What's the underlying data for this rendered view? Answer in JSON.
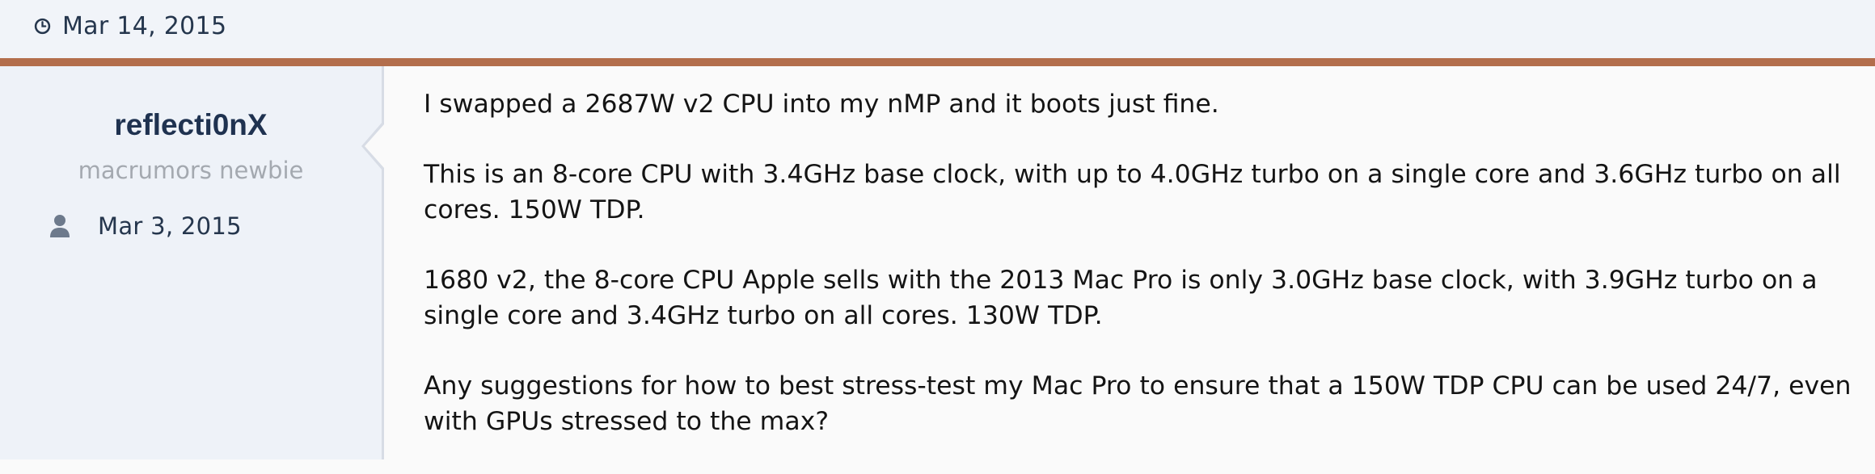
{
  "post": {
    "date": "Mar 14, 2015",
    "date_icon": "clock-icon"
  },
  "colors": {
    "header_bg": "#f1f4f9",
    "accent": "#b36e4c",
    "user_panel_bg": "#eef2f8",
    "username": "#1f3250",
    "user_title": "#a4a9b0",
    "body_text": "#141414"
  },
  "user": {
    "name": "reflecti0nX",
    "title": "macrumors newbie",
    "joined": "Mar 3, 2015",
    "joined_icon": "user-icon"
  },
  "message": {
    "paragraphs": [
      "I swapped a 2687W v2 CPU into my nMP and it boots just fine.",
      "This is an 8-core CPU with 3.4GHz base clock, with up to 4.0GHz turbo on a single core and 3.6GHz turbo on all cores. 150W TDP.",
      "1680 v2, the 8-core CPU Apple sells with the 2013 Mac Pro is only 3.0GHz base clock, with 3.9GHz turbo on a single core and 3.4GHz turbo on all cores. 130W TDP.",
      "Any suggestions for how to best stress-test my Mac Pro to ensure that a 150W TDP CPU can be used 24/7, even with GPUs stressed to the max?"
    ]
  }
}
